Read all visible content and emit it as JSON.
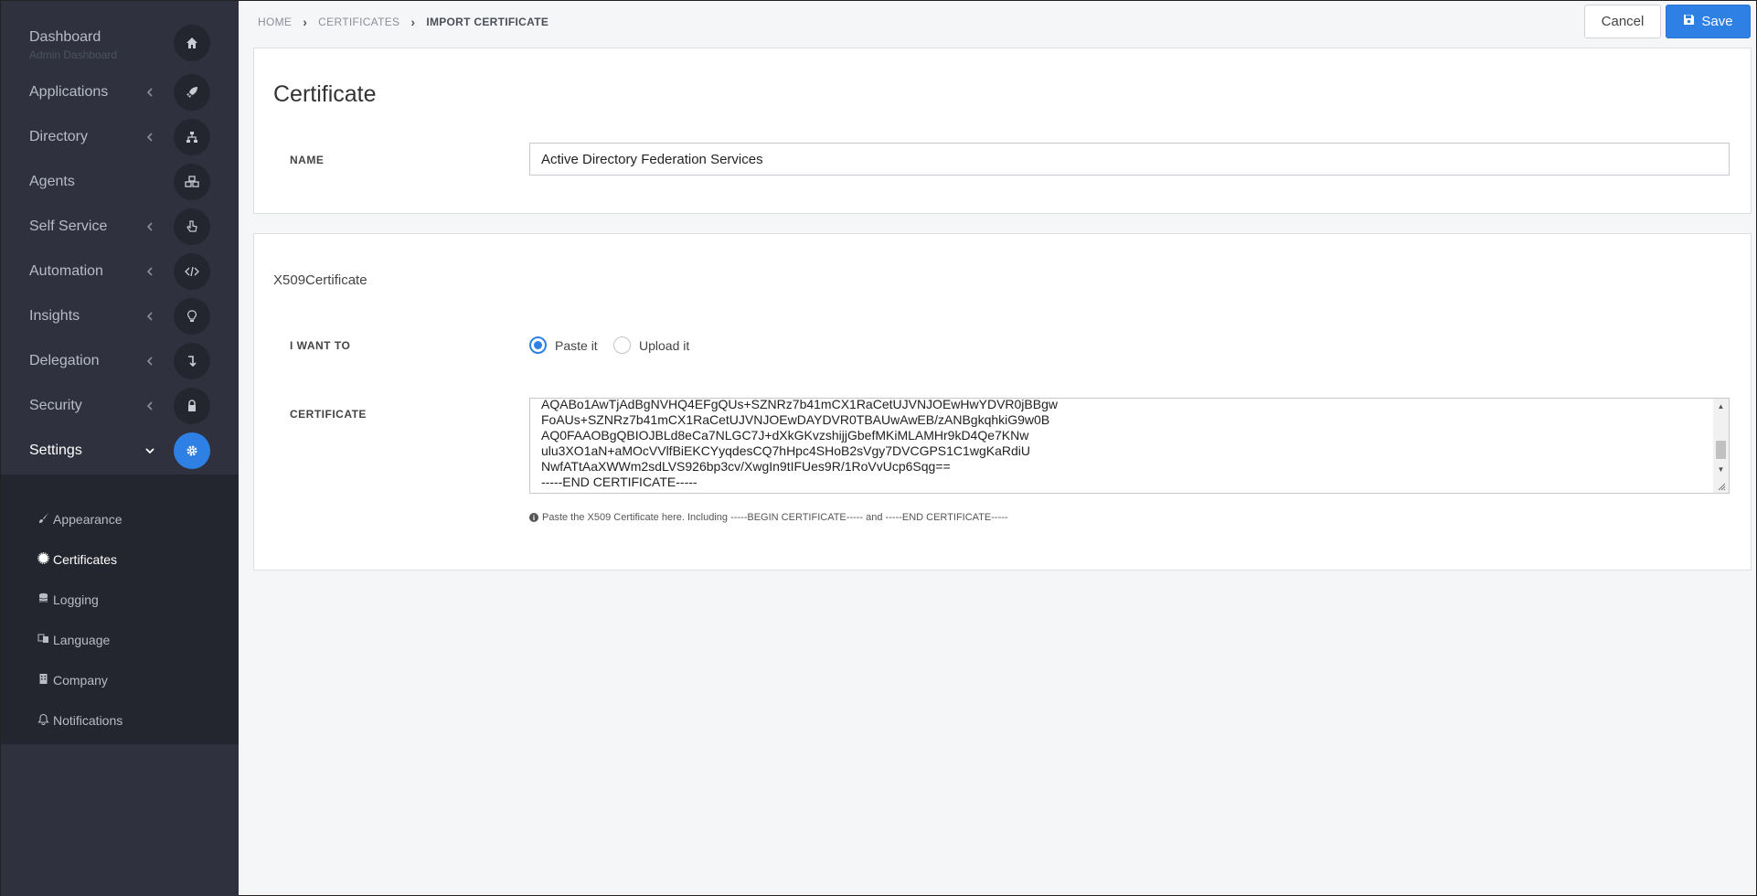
{
  "sidebar": {
    "dashboard": {
      "label": "Dashboard",
      "sub": "Admin Dashboard"
    },
    "items": [
      {
        "label": "Applications"
      },
      {
        "label": "Directory"
      },
      {
        "label": "Agents"
      },
      {
        "label": "Self Service"
      },
      {
        "label": "Automation"
      },
      {
        "label": "Insights"
      },
      {
        "label": "Delegation"
      },
      {
        "label": "Security"
      },
      {
        "label": "Settings"
      }
    ],
    "subitems": [
      {
        "label": "Appearance"
      },
      {
        "label": "Certificates"
      },
      {
        "label": "Logging"
      },
      {
        "label": "Language"
      },
      {
        "label": "Company"
      },
      {
        "label": "Notifications"
      }
    ]
  },
  "breadcrumb": {
    "home": "HOME",
    "certificates": "CERTIFICATES",
    "current": "IMPORT CERTIFICATE"
  },
  "toolbar": {
    "cancel_label": "Cancel",
    "save_label": "Save"
  },
  "card1": {
    "title": "Certificate",
    "name_label": "NAME",
    "name_value": "Active Directory Federation Services"
  },
  "card2": {
    "title": "X509Certificate",
    "iwantto_label": "I WANT TO",
    "radio_paste": "Paste it",
    "radio_upload": "Upload it",
    "certificate_label": "CERTIFICATE",
    "certificate_value": "AQABo1AwTjAdBgNVHQ4EFgQUs+SZNRz7b41mCX1RaCetUJVNJOEwHwYDVR0jBBgw\nFoAUs+SZNRz7b41mCX1RaCetUJVNJOEwDAYDVR0TBAUwAwEB/zANBgkqhkiG9w0B\nAQ0FAAOBgQBIOJBLd8eCa7NLGC7J+dXkGKvzshijjGbefMKiMLAMHr9kD4Qe7KNw\nulu3XO1aN+aMOcVVlfBiEKCYyqdesCQ7hHpc4SHoB2sVgy7DVCGPS1C1wgKaRdiU\nNwfATtAaXWWm2sdLVS926bp3cv/XwgIn9tIFUes9R/1RoVvUcp6Sqg==\n-----END CERTIFICATE-----",
    "hint": "Paste the X509 Certificate here. Including -----BEGIN CERTIFICATE----- and -----END CERTIFICATE-----"
  },
  "colors": {
    "accent": "#2f80e4",
    "sidebar": "#2f323e",
    "subnav": "#24262f"
  }
}
